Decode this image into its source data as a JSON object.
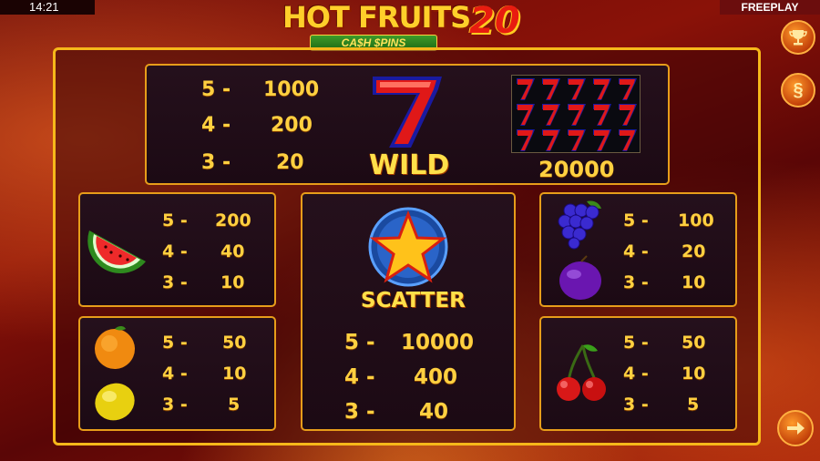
{
  "status_bar": {
    "time": "14:21",
    "mode": "FREEPLAY"
  },
  "logo": {
    "title": "HOT FRUITS",
    "number": "20",
    "subtitle": "CA$H $PINS"
  },
  "wild": {
    "label": "WILD",
    "pays": [
      {
        "count": "5 -",
        "value": "1000"
      },
      {
        "count": "4 -",
        "value": "200"
      },
      {
        "count": "3 -",
        "value": "20"
      }
    ],
    "full_screen_value": "20000"
  },
  "scatter": {
    "label": "SCATTER",
    "pays": [
      {
        "count": "5 -",
        "value": "10000"
      },
      {
        "count": "4 -",
        "value": "400"
      },
      {
        "count": "3 -",
        "value": "40"
      }
    ]
  },
  "symbol_groups": {
    "watermelon": [
      {
        "count": "5 -",
        "value": "200"
      },
      {
        "count": "4 -",
        "value": "40"
      },
      {
        "count": "3 -",
        "value": "10"
      }
    ],
    "orange_lemon": [
      {
        "count": "5 -",
        "value": "50"
      },
      {
        "count": "4 -",
        "value": "10"
      },
      {
        "count": "3 -",
        "value": "5"
      }
    ],
    "grape_plum": [
      {
        "count": "5 -",
        "value": "100"
      },
      {
        "count": "4 -",
        "value": "20"
      },
      {
        "count": "3 -",
        "value": "10"
      }
    ],
    "cherry": [
      {
        "count": "5 -",
        "value": "50"
      },
      {
        "count": "4 -",
        "value": "10"
      },
      {
        "count": "3 -",
        "value": "5"
      }
    ]
  },
  "side_buttons": {
    "rules_symbol": "§"
  },
  "icons": {
    "trophy": "trophy-icon",
    "rules": "section-sign-icon",
    "next": "arrow-right-icon"
  },
  "colors": {
    "frame": "#f6b81a",
    "payout_text": "#ffd040",
    "accent_red": "#e81c10"
  }
}
